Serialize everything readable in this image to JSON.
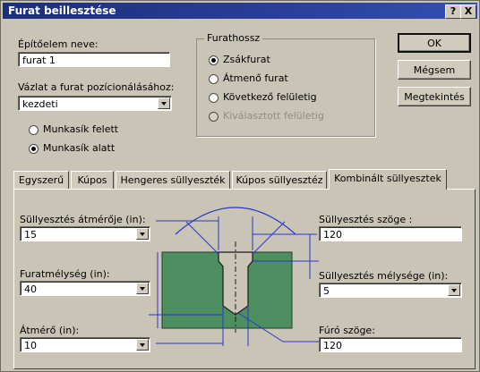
{
  "window": {
    "title": "Furat beillesztése",
    "help": "?",
    "close": "X"
  },
  "form": {
    "element_name_label": "Építőelem neve:",
    "element_name_value": "furat 1",
    "sketch_label": "Vázlat a furat pozícionálásához:",
    "sketch_value": "kezdeti",
    "placement": [
      {
        "label": "Munkasík felett",
        "selected": false
      },
      {
        "label": "Munkasík alatt",
        "selected": true
      }
    ]
  },
  "depth_group": {
    "caption": "Furathossz",
    "options": [
      {
        "label": "Zsákfurat",
        "selected": true,
        "enabled": true
      },
      {
        "label": "Átmenő furat",
        "selected": false,
        "enabled": true
      },
      {
        "label": "Következő felületig",
        "selected": false,
        "enabled": true
      },
      {
        "label": "Kiválasztott felületig",
        "selected": false,
        "enabled": false
      }
    ]
  },
  "buttons": {
    "ok": "OK",
    "cancel": "Mégsem",
    "preview": "Megtekintés"
  },
  "tabs": [
    "Egyszerű",
    "Kúpos",
    "Hengeres süllyeszték",
    "Kúpos süllyesztéz",
    "Kombinált süllyesztek"
  ],
  "active_tab": 4,
  "params": {
    "countersink_diameter": {
      "label": "Süllyesztés átmérője (in):",
      "value": "15"
    },
    "hole_depth": {
      "label": "Furatmélység (in):",
      "value": "40"
    },
    "diameter": {
      "label": "Átmérő (in):",
      "value": "10"
    },
    "countersink_angle": {
      "label": "Süllyesztés szöge :",
      "value": "120"
    },
    "countersink_depth": {
      "label": "Süllyesztés mélysége (in):",
      "value": "5"
    },
    "drill_angle": {
      "label": "Fúró szöge:",
      "value": "120"
    }
  },
  "colors": {
    "title_bar": "#1c2f7a",
    "part_fill": "#4e8f62",
    "dim_lines": "#2a36c8"
  }
}
